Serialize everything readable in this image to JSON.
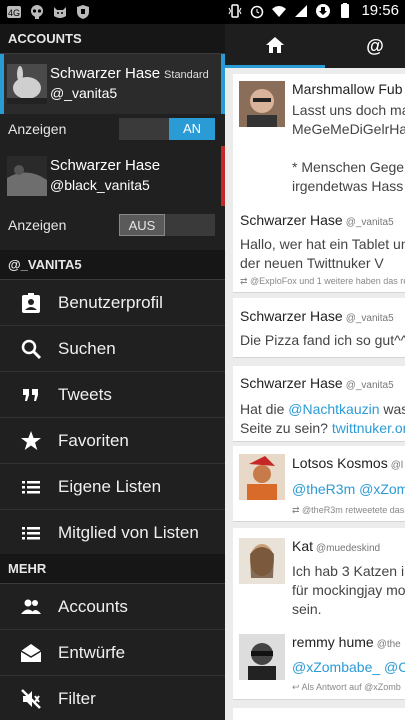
{
  "statusbar": {
    "time": "19:56",
    "left_icons": [
      "signal-booster-icon",
      "skull-icon",
      "cat-icon",
      "shield-icon"
    ],
    "right_icons": [
      "vibrate-icon",
      "alarm-icon",
      "wifi-icon",
      "data-sync-icon",
      "battery-icon"
    ]
  },
  "drawer": {
    "accounts_header": "ACCOUNTS",
    "accounts": [
      {
        "name": "Schwarzer Hase",
        "badge": "Standard",
        "handle": "@_vanita5",
        "show_label": "Anzeigen",
        "toggle": "AN",
        "enabled": true,
        "accent": "#2b9bd6"
      },
      {
        "name": "Schwarzer Hase",
        "badge": "",
        "handle": "@black_vanita5",
        "show_label": "Anzeigen",
        "toggle": "AUS",
        "enabled": false,
        "accent": "#c62828"
      }
    ],
    "user_header": "@_VANITA5",
    "user_items": [
      {
        "label": "Benutzerprofil",
        "icon": "profile-icon"
      },
      {
        "label": "Suchen",
        "icon": "search-icon"
      },
      {
        "label": "Tweets",
        "icon": "quote-icon"
      },
      {
        "label": "Favoriten",
        "icon": "star-icon"
      },
      {
        "label": "Eigene Listen",
        "icon": "list-icon"
      },
      {
        "label": "Mitglied von Listen",
        "icon": "list-icon"
      }
    ],
    "more_header": "MEHR",
    "more_items": [
      {
        "label": "Accounts",
        "icon": "accounts-icon"
      },
      {
        "label": "Entwürfe",
        "icon": "drafts-icon"
      },
      {
        "label": "Filter",
        "icon": "filter-icon"
      }
    ]
  },
  "timeline": {
    "tabs": [
      {
        "icon": "home-icon",
        "label": ""
      },
      {
        "icon": "mention-icon",
        "label": "@"
      }
    ],
    "tweets": [
      {
        "name": "Marshmallow Fub",
        "handle": "",
        "lines": [
          "Lasst uns doch ma",
          "MeGeMeDiGelrHa",
          "",
          "* Menschen Gegen",
          "irgendetwas Hass"
        ],
        "meta": ""
      },
      {
        "name": "Schwarzer Hase",
        "handle": "@_vanita5",
        "lines": [
          "Hallo, wer hat ein Tablet un",
          "der neuen Twittnuker V"
        ],
        "meta": "@ExploFox und 1 weitere haben das re"
      },
      {
        "name": "Schwarzer Hase",
        "handle": "@_vanita5",
        "lines": [
          "Die Pizza fand ich so gut^^"
        ],
        "meta": ""
      },
      {
        "name": "Schwarzer Hase",
        "handle": "@_vanita5",
        "lines": [
          "Hat die @Nachtkauzin was",
          "Seite zu sein? twittnuker.or"
        ],
        "meta": ""
      },
      {
        "name": "Lotsos Kosmos",
        "handle": "@l",
        "lines": [
          "@theR3m @xZomb"
        ],
        "meta": "@theR3m retweetete das"
      },
      {
        "name": "Kat",
        "handle": "@muedeskind",
        "lines": [
          "Ich hab 3 Katzen ir",
          "für mockingjay mo",
          "sein."
        ],
        "meta": ""
      },
      {
        "name": "remmy hume",
        "handle": "@the",
        "lines": [
          "@xZombabe_ @C"
        ],
        "meta": "Als Antwort auf @xZomb"
      }
    ]
  },
  "colors": {
    "accent": "#2b9bd6",
    "drawer_bg": "#202020",
    "timeline_bg": "#ececec",
    "inactive_accent": "#c62828"
  }
}
